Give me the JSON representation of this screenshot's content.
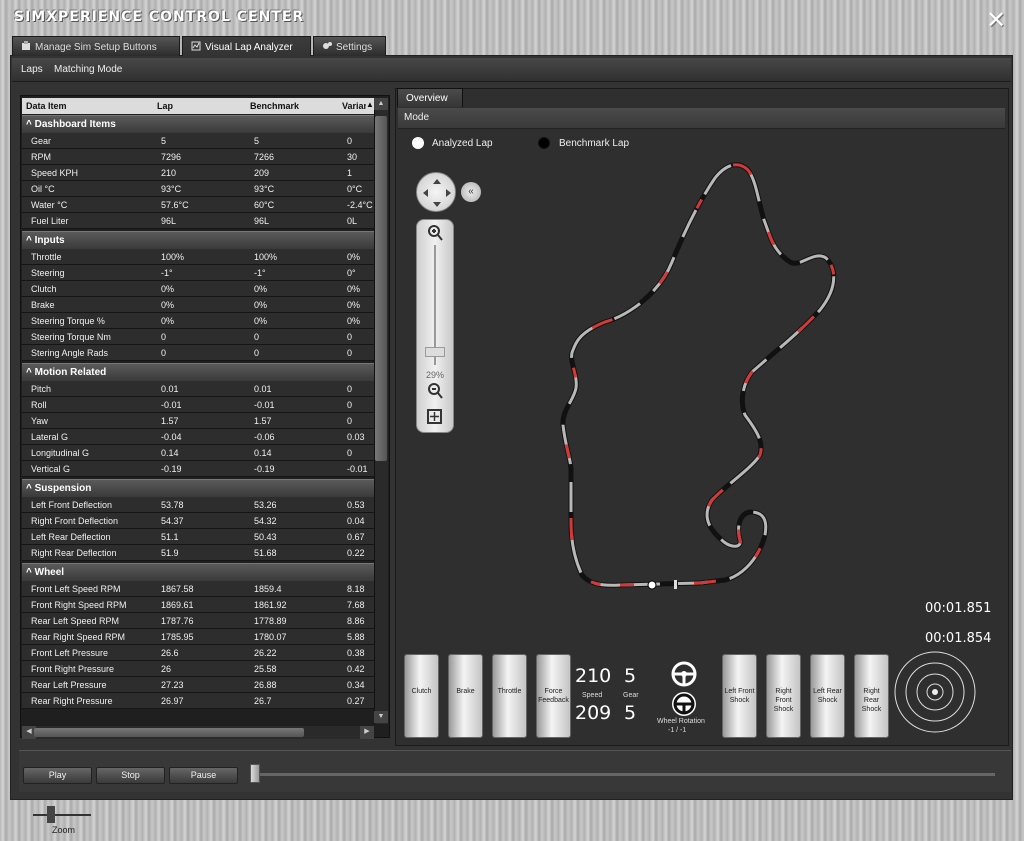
{
  "window": {
    "title": "SIMXPERIENCE CONTROL CENTER"
  },
  "tabs": [
    {
      "label": "Manage Sim Setup Buttons",
      "icon": "wrench-icon"
    },
    {
      "label": "Visual Lap Analyzer",
      "icon": "chart-icon"
    },
    {
      "label": "Settings",
      "icon": "gears-icon"
    }
  ],
  "menu": [
    "Laps",
    "Matching Mode"
  ],
  "table": {
    "headers": [
      "Data Item",
      "Lap",
      "Benchmark",
      "Varianc"
    ],
    "sections": [
      {
        "title": "Dashboard Items",
        "rows": [
          [
            "Gear",
            "5",
            "5",
            "0"
          ],
          [
            "RPM",
            "7296",
            "7266",
            "30"
          ],
          [
            "Speed KPH",
            "210",
            "209",
            "1"
          ],
          [
            "Oil °C",
            "93°C",
            "93°C",
            "0°C"
          ],
          [
            "Water °C",
            "57.6°C",
            "60°C",
            "-2.4°C"
          ],
          [
            "Fuel Liter",
            "96L",
            "96L",
            "0L"
          ]
        ]
      },
      {
        "title": "Inputs",
        "rows": [
          [
            "Throttle",
            "100%",
            "100%",
            "0%"
          ],
          [
            "Steering",
            "-1°",
            "-1°",
            "0°"
          ],
          [
            "Clutch",
            "0%",
            "0%",
            "0%"
          ],
          [
            "Brake",
            "0%",
            "0%",
            "0%"
          ],
          [
            "Steering Torque %",
            "0%",
            "0%",
            "0%"
          ],
          [
            "Steering Torque Nm",
            "0",
            "0",
            "0"
          ],
          [
            "Stering Angle Rads",
            "0",
            "0",
            "0"
          ]
        ]
      },
      {
        "title": "Motion Related",
        "rows": [
          [
            "Pitch",
            "0.01",
            "0.01",
            "0"
          ],
          [
            "Roll",
            "-0.01",
            "-0.01",
            "0"
          ],
          [
            "Yaw",
            "1.57",
            "1.57",
            "0"
          ],
          [
            "Lateral G",
            "-0.04",
            "-0.06",
            "0.03"
          ],
          [
            "Longitudinal G",
            "0.14",
            "0.14",
            "0"
          ],
          [
            "Vertical G",
            "-0.19",
            "-0.19",
            "-0.01"
          ]
        ]
      },
      {
        "title": "Suspension",
        "rows": [
          [
            "Left Front Deflection",
            "53.78",
            "53.26",
            "0.53"
          ],
          [
            "Right Front Deflection",
            "54.37",
            "54.32",
            "0.04"
          ],
          [
            "Left Rear Deflection",
            "51.1",
            "50.43",
            "0.67"
          ],
          [
            "Right Rear Deflection",
            "51.9",
            "51.68",
            "0.22"
          ]
        ]
      },
      {
        "title": "Wheel",
        "rows": [
          [
            "Front Left Speed RPM",
            "1867.58",
            "1859.4",
            "8.18"
          ],
          [
            "Front Right Speed RPM",
            "1869.61",
            "1861.92",
            "7.68"
          ],
          [
            "Rear Left Speed RPM",
            "1787.76",
            "1778.89",
            "8.86"
          ],
          [
            "Rear Right Speed RPM",
            "1785.95",
            "1780.07",
            "5.88"
          ],
          [
            "Front Left Pressure",
            "26.6",
            "26.22",
            "0.38"
          ],
          [
            "Front Right Pressure",
            "26",
            "25.58",
            "0.42"
          ],
          [
            "Rear Left Pressure",
            "27.23",
            "26.88",
            "0.34"
          ],
          [
            "Rear Right Pressure",
            "26.97",
            "26.7",
            "0.27"
          ]
        ]
      }
    ]
  },
  "overview": {
    "tab": "Overview",
    "mode_label": "Mode",
    "legend": [
      {
        "label": "Analyzed Lap",
        "color": "#ffffff"
      },
      {
        "label": "Benchmark Lap",
        "color": "#000000"
      }
    ],
    "zoom_percent": "29%",
    "times": {
      "analyzed": "00:01.851",
      "benchmark": "00:01.854"
    }
  },
  "dash": {
    "gauges": [
      "Clutch",
      "Brake",
      "Throttle",
      "Force Feedback"
    ],
    "speed_label": "Speed",
    "gear_label": "Gear",
    "speed_a": "210",
    "gear_a": "5",
    "speed_b": "209",
    "gear_b": "5",
    "wheel_rotation_label": "Wheel Rotation",
    "wheel_rotation_value": "-1 / -1",
    "shocks": [
      "Left Front Shock",
      "Right Front Shock",
      "Left Rear Shock",
      "Right Rear Shock"
    ],
    "colors": {
      "faster": "#2e8b3a",
      "slower": "#d23a3a",
      "neutral": "#b8b8b8"
    }
  },
  "transport": {
    "play": "Play",
    "stop": "Stop",
    "pause": "Pause"
  },
  "zoom_label": "Zoom"
}
